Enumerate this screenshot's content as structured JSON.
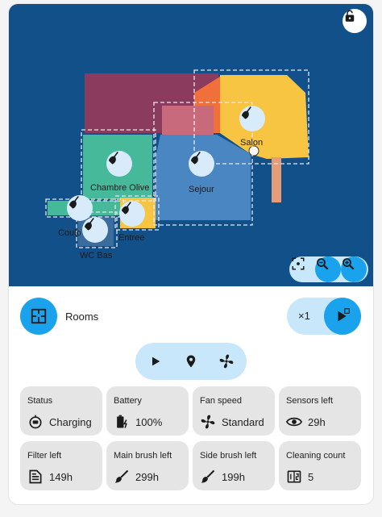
{
  "map": {
    "rooms": [
      {
        "name": "Salon"
      },
      {
        "name": "Chambre Olive"
      },
      {
        "name": "Sejour"
      },
      {
        "name": "Couloir"
      },
      {
        "name": "WC Bas"
      },
      {
        "name": "Entree"
      }
    ],
    "icons": {
      "lock": "lock-icon",
      "recenter": "recenter-icon",
      "zoom_out": "zoom-out-icon",
      "zoom_in": "zoom-in-icon"
    }
  },
  "mode": {
    "label": "Rooms",
    "icon": "floor-plan-icon"
  },
  "repeat": {
    "count": "×1"
  },
  "actions": [
    "play-icon",
    "location-pin-icon",
    "fan-icon"
  ],
  "tiles": [
    {
      "title": "Status",
      "value": "Charging",
      "icon": "robot-charging-icon"
    },
    {
      "title": "Battery",
      "value": "100%",
      "icon": "battery-charging-icon"
    },
    {
      "title": "Fan speed",
      "value": "Standard",
      "icon": "fan-icon"
    },
    {
      "title": "Sensors left",
      "value": "29h",
      "icon": "eye-icon"
    },
    {
      "title": "Filter left",
      "value": "149h",
      "icon": "filter-icon"
    },
    {
      "title": "Main brush left",
      "value": "299h",
      "icon": "brush-icon"
    },
    {
      "title": "Side brush left",
      "value": "199h",
      "icon": "brush-icon"
    },
    {
      "title": "Cleaning count",
      "value": "5",
      "icon": "counter-icon"
    }
  ],
  "colors": {
    "accent": "#1aa3ec",
    "accent_light": "#c9e7fb",
    "map_bg": "#12508a",
    "tile_bg": "#e5e5e5"
  }
}
